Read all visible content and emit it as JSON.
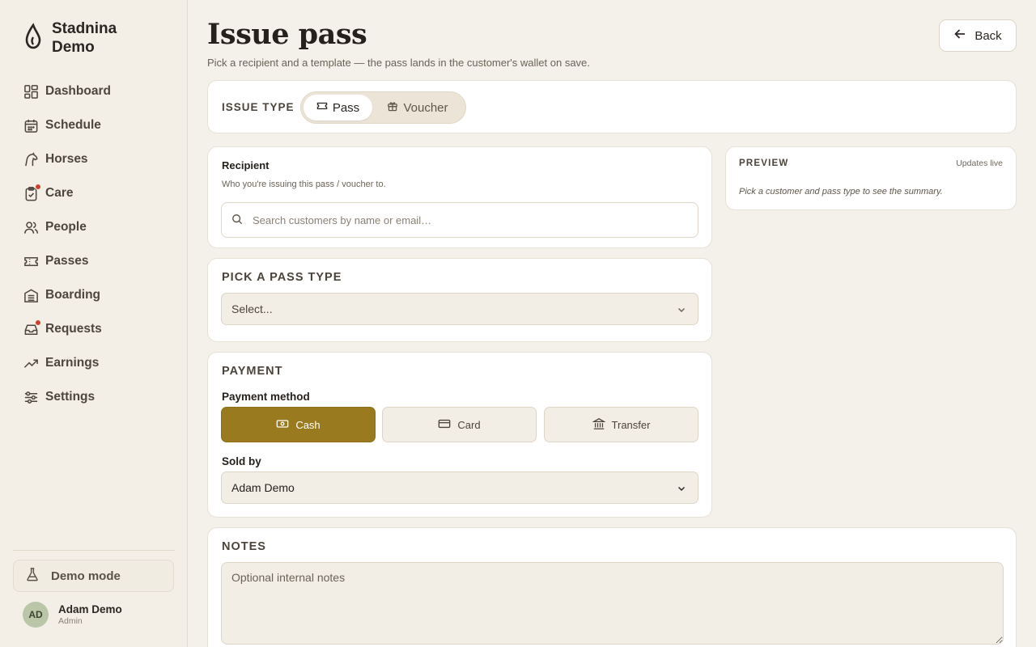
{
  "brand": {
    "name": "Stadnina Demo"
  },
  "nav": [
    {
      "label": "Dashboard",
      "icon": "dashboard-icon",
      "dot": false
    },
    {
      "label": "Schedule",
      "icon": "calendar-icon",
      "dot": false
    },
    {
      "label": "Horses",
      "icon": "horse-icon",
      "dot": false
    },
    {
      "label": "Care",
      "icon": "clipboard-check-icon",
      "dot": true
    },
    {
      "label": "People",
      "icon": "people-icon",
      "dot": false
    },
    {
      "label": "Passes",
      "icon": "ticket-icon",
      "dot": false
    },
    {
      "label": "Boarding",
      "icon": "building-icon",
      "dot": false
    },
    {
      "label": "Requests",
      "icon": "inbox-icon",
      "dot": true
    },
    {
      "label": "Earnings",
      "icon": "trending-up-icon",
      "dot": false
    },
    {
      "label": "Settings",
      "icon": "sliders-icon",
      "dot": false
    }
  ],
  "sidebar_footer": {
    "demo_mode": "Demo mode",
    "user": {
      "initials": "AD",
      "name": "Adam Demo",
      "role": "Admin"
    }
  },
  "header": {
    "title": "Issue pass",
    "subtitle": "Pick a recipient and a template — the pass lands in the customer's wallet on save.",
    "back_label": "Back"
  },
  "issue_type": {
    "label": "ISSUE TYPE",
    "options": [
      "Pass",
      "Voucher"
    ],
    "selected": "Pass"
  },
  "recipient": {
    "title": "Recipient",
    "description": "Who you're issuing this pass / voucher to.",
    "search_placeholder": "Search customers by name or email…"
  },
  "preview": {
    "title": "PREVIEW",
    "live_label": "Updates live",
    "empty_text": "Pick a customer and pass type to see the summary."
  },
  "pass_type": {
    "title": "PICK A PASS TYPE",
    "select_value": "Select..."
  },
  "payment": {
    "title": "PAYMENT",
    "method_label": "Payment method",
    "methods": [
      "Cash",
      "Card",
      "Transfer"
    ],
    "selected_method": "Cash",
    "sold_by_label": "Sold by",
    "sold_by_value": "Adam Demo"
  },
  "notes": {
    "title": "NOTES",
    "placeholder": "Optional internal notes"
  },
  "colors": {
    "accent": "#9a7a1f",
    "background": "#f4f1ea",
    "badge_dot": "#c9432f"
  }
}
